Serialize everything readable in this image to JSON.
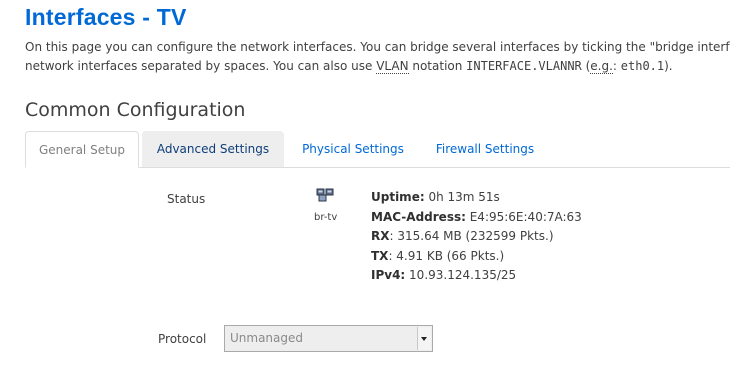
{
  "page": {
    "title": "Interfaces - TV",
    "description_line1": "On this page you can configure the network interfaces. You can bridge several interfaces by ticking the \"bridge interfaces\"",
    "description_line2_a": "network interfaces separated by spaces. You can also use ",
    "vlan_abbr": "VLAN",
    "description_line2_b": " notation ",
    "notation_code": "INTERFACE.VLANNR",
    "description_line2_c": " (",
    "eg_abbr": "e.g.",
    "description_line2_d": ": ",
    "example_code": "eth0.1",
    "description_line2_e": ")."
  },
  "section": {
    "title": "Common Configuration"
  },
  "tabs": {
    "general": "General Setup",
    "advanced": "Advanced Settings",
    "physical": "Physical Settings",
    "firewall": "Firewall Settings"
  },
  "status": {
    "label": "Status",
    "icon": "ethernet-switch-icon",
    "iface_name": "br-tv",
    "uptime_label": "Uptime:",
    "uptime_value": " 0h 13m 51s",
    "mac_label": "MAC-Address:",
    "mac_value": " E4:95:6E:40:7A:63",
    "rx_label": "RX",
    "rx_value": ": 315.64 MB (232599 Pkts.)",
    "tx_label": "TX",
    "tx_value": ": 4.91 KB (66 Pkts.)",
    "ipv4_label": "IPv4:",
    "ipv4_value": " 10.93.124.135/25"
  },
  "protocol": {
    "label": "Protocol",
    "selected": "Unmanaged"
  }
}
